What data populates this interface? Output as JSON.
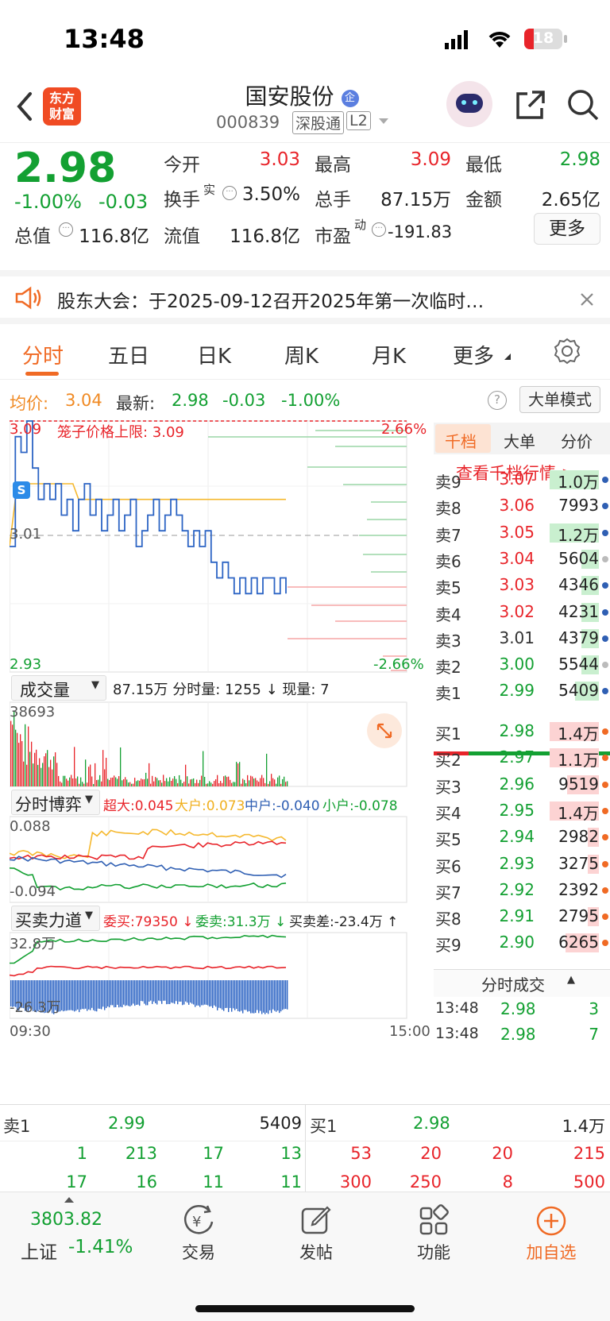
{
  "status_bar": {
    "time": "13:48",
    "battery": "18"
  },
  "header": {
    "title": "国安股份",
    "badge": "企",
    "code": "000839",
    "tag1": "深股通",
    "tag2": "L2",
    "logo_line1": "东方",
    "logo_line2": "财富"
  },
  "quote": {
    "price": "2.98",
    "change_pct": "-1.00%",
    "change": "-0.03",
    "open_label": "今开",
    "open": "3.03",
    "high_label": "最高",
    "high": "3.09",
    "low_label": "最低",
    "low": "2.98",
    "turnover_label": "换手",
    "turnover_sup": "实",
    "turnover": "3.50%",
    "volume_label": "总手",
    "volume": "87.15万",
    "amount_label": "金额",
    "amount": "2.65亿",
    "mcap_label": "总值",
    "mcap": "116.8亿",
    "float_label": "流值",
    "float": "116.8亿",
    "pe_label": "市盈",
    "pe_sup": "动",
    "pe": "-191.83",
    "more_button": "更多"
  },
  "notice": {
    "text": "股东大会：于2025-09-12召开2025年第一次临时…"
  },
  "tabs": [
    "分时",
    "五日",
    "日K",
    "周K",
    "月K",
    "更多"
  ],
  "info": {
    "avg_label": "均价:",
    "avg": "3.04",
    "latest_label": "最新:",
    "latest": "2.98",
    "chg": "-0.03",
    "pct": "-1.00%",
    "mode_button": "大单模式"
  },
  "chart": {
    "top_price": "3.09",
    "limit_label": "笼子价格上限: 3.09",
    "top_pct": "2.66%",
    "mid_price": "3.01",
    "bottom_price": "2.93",
    "bottom_pct": "-2.66%",
    "vol_selector": "成交量",
    "vol_info": "87.15万 分时量: 1255 ↓ 现量: 7",
    "vol_max": "38693",
    "game_selector": "分时博弈",
    "game_super": "超大:0.045",
    "game_big": "大户:0.073",
    "game_mid": "中户:-0.040",
    "game_small": "小户:-0.078",
    "game_top": "0.088",
    "game_bottom": "-0.094",
    "force_selector": "买卖力道",
    "force_buy": "委买:79350 ↓",
    "force_sell": "委卖:31.3万 ↓",
    "force_diff": "买卖差:-23.4万 ↑",
    "force_top": "32.8万",
    "force_bottom": "-26.3万",
    "time_start": "09:30",
    "time_end": "15:00"
  },
  "chart_data": {
    "type": "line",
    "x_range": [
      "09:30",
      "15:00"
    ],
    "ylim": [
      2.93,
      3.09
    ],
    "reference_price": 3.01,
    "series": [
      {
        "values": [
          3.01,
          3.08,
          3.07,
          3.09,
          3.06,
          3.04,
          3.05,
          3.04,
          3.05,
          3.03,
          3.04,
          3.02,
          3.04,
          3.05,
          3.03,
          3.04,
          3.02,
          3.03,
          3.04,
          3.02,
          3.03,
          3.04,
          3.01,
          3.02,
          3.03,
          3.04,
          3.02,
          3.03,
          3.04,
          3.03,
          3.02,
          3.01,
          3.02,
          3.01,
          3.02,
          3.0,
          2.99,
          3.0,
          2.99,
          2.98,
          2.99,
          2.98,
          2.99,
          2.98,
          2.99,
          2.99,
          2.98,
          2.99,
          2.98
        ]
      },
      {
        "values": [
          3.01,
          3.04,
          3.05,
          3.05,
          3.05,
          3.05,
          3.05,
          3.05,
          3.05,
          3.05,
          3.05,
          3.05,
          3.04,
          3.04,
          3.04,
          3.04,
          3.04,
          3.04,
          3.04,
          3.04,
          3.04,
          3.04,
          3.04,
          3.04,
          3.04,
          3.04,
          3.04,
          3.04,
          3.04,
          3.04,
          3.04,
          3.04,
          3.04,
          3.04,
          3.04,
          3.04,
          3.04,
          3.04,
          3.04,
          3.04,
          3.04,
          3.04,
          3.04,
          3.04,
          3.04,
          3.04,
          3.04,
          3.04,
          3.04
        ]
      }
    ]
  },
  "orderbook": {
    "tabs": [
      "千档",
      "大单",
      "分价"
    ],
    "link": "查看千档行情 >",
    "asks": [
      {
        "label": "卖9",
        "price": "3.07",
        "vol": "1.0万"
      },
      {
        "label": "卖8",
        "price": "3.06",
        "vol": "7993"
      },
      {
        "label": "卖7",
        "price": "3.05",
        "vol": "1.2万"
      },
      {
        "label": "卖6",
        "price": "3.04",
        "vol": "5604"
      },
      {
        "label": "卖5",
        "price": "3.03",
        "vol": "4346"
      },
      {
        "label": "卖4",
        "price": "3.02",
        "vol": "4231"
      },
      {
        "label": "卖3",
        "price": "3.01",
        "vol": "4379"
      },
      {
        "label": "卖2",
        "price": "3.00",
        "vol": "5544"
      },
      {
        "label": "卖1",
        "price": "2.99",
        "vol": "5409"
      }
    ],
    "bids": [
      {
        "label": "买1",
        "price": "2.98",
        "vol": "1.4万"
      },
      {
        "label": "买2",
        "price": "2.97",
        "vol": "1.1万"
      },
      {
        "label": "买3",
        "price": "2.96",
        "vol": "9519"
      },
      {
        "label": "买4",
        "price": "2.95",
        "vol": "1.4万"
      },
      {
        "label": "买5",
        "price": "2.94",
        "vol": "2982"
      },
      {
        "label": "买6",
        "price": "2.93",
        "vol": "3275"
      },
      {
        "label": "买7",
        "price": "2.92",
        "vol": "2392"
      },
      {
        "label": "买8",
        "price": "2.91",
        "vol": "2795"
      },
      {
        "label": "买9",
        "price": "2.90",
        "vol": "6265"
      }
    ],
    "trades_title": "分时成交",
    "trades": [
      {
        "time": "13:48",
        "price": "2.98",
        "vol": "3"
      },
      {
        "time": "13:48",
        "price": "2.98",
        "vol": "7"
      }
    ]
  },
  "bottom_book": {
    "sell_label": "卖1",
    "sell_price": "2.99",
    "sell_vol": "5409",
    "buy_label": "买1",
    "buy_price": "2.98",
    "buy_vol": "1.4万",
    "sell_row1": [
      "1",
      "213",
      "17",
      "13"
    ],
    "sell_row2": [
      "17",
      "16",
      "11",
      "11"
    ],
    "buy_row1": [
      "53",
      "20",
      "20",
      "215"
    ],
    "buy_row2": [
      "300",
      "250",
      "8",
      "500"
    ]
  },
  "nav": {
    "index_value": "3803.82",
    "index_name": "上证",
    "index_pct": "-1.41%",
    "items": [
      "交易",
      "发帖",
      "功能",
      "加自选"
    ]
  }
}
